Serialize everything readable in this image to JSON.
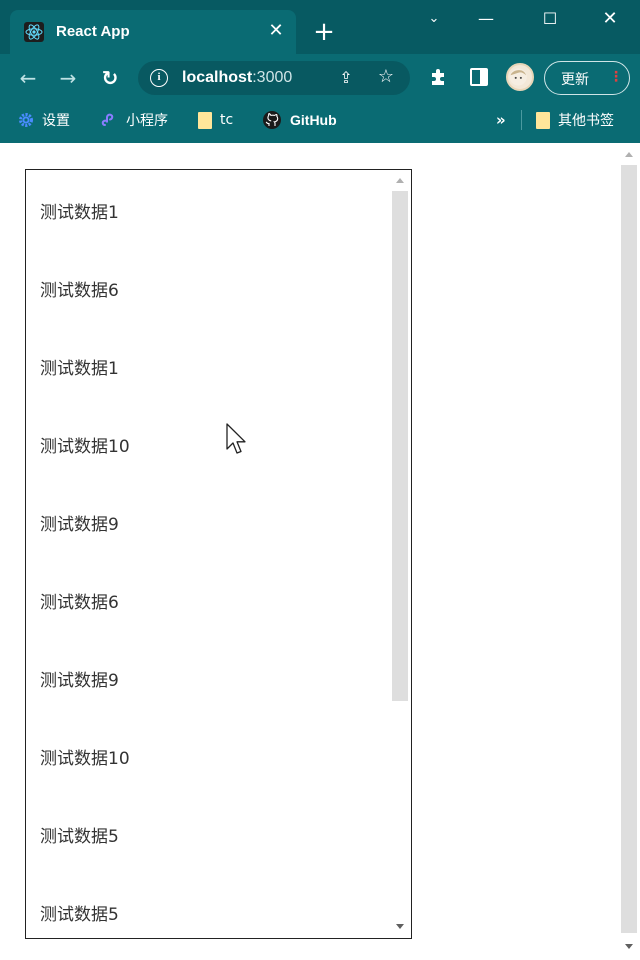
{
  "browser": {
    "tab": {
      "title": "React App",
      "close_glyph": "✕",
      "favicon": "react-icon"
    },
    "new_tab_glyph": "+",
    "window_controls": {
      "dropdown": "⌄",
      "minimize": "—",
      "maximize": "☐",
      "close": "✕"
    },
    "toolbar": {
      "back_glyph": "←",
      "forward_glyph": "→",
      "reload_glyph": "↻",
      "url_host": "localhost",
      "url_port": ":3000",
      "info_glyph": "i",
      "share_glyph": "⇪",
      "star_glyph": "☆",
      "update_label": "更新",
      "update_menu_glyph": "⋮"
    },
    "bookmarks": {
      "items": [
        {
          "label": "设置",
          "icon": "gear-icon"
        },
        {
          "label": "小程序",
          "icon": "mini-program-icon"
        },
        {
          "label": "tc",
          "icon": "folder-icon"
        },
        {
          "label": "GitHub",
          "icon": "github-icon"
        }
      ],
      "more_glyph": "»",
      "other": {
        "label": "其他书签",
        "icon": "folder-icon"
      }
    },
    "colors": {
      "tab_bg": "#0a6b73",
      "titlebar_bg": "#075a62"
    }
  },
  "list": {
    "items": [
      "测试数据1",
      "测试数据6",
      "测试数据1",
      "测试数据10",
      "测试数据9",
      "测试数据6",
      "测试数据9",
      "测试数据10",
      "测试数据5",
      "测试数据5"
    ]
  }
}
